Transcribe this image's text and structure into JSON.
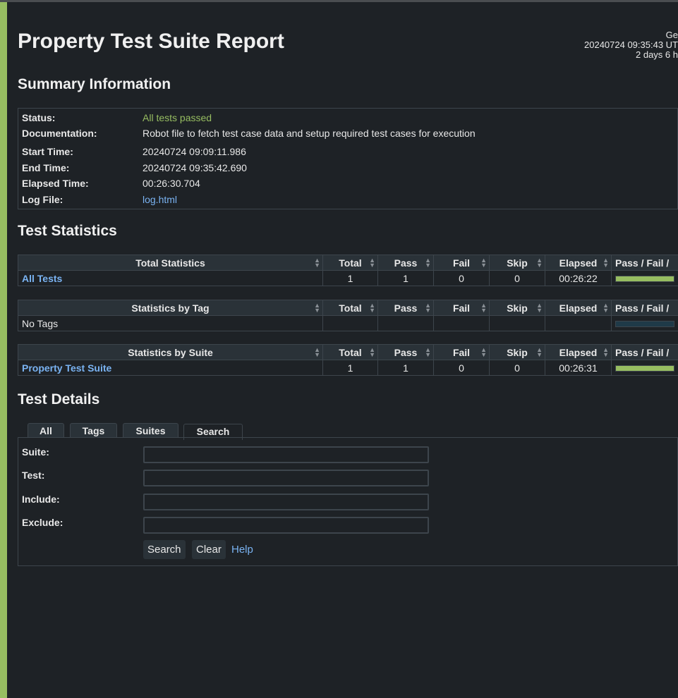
{
  "title": "Property Test Suite Report",
  "generated": {
    "line1": "Ge",
    "line2": "20240724 09:35:43 UT",
    "line3": "2 days 6 h"
  },
  "summary": {
    "heading": "Summary Information",
    "rows": [
      {
        "label": "Status:",
        "value": "All tests passed"
      },
      {
        "label": "Documentation:",
        "value": "Robot file to fetch test case data and setup required test cases for execution"
      },
      {
        "label": "Start Time:",
        "value": "20240724 09:09:11.986"
      },
      {
        "label": "End Time:",
        "value": "20240724 09:35:42.690"
      },
      {
        "label": "Elapsed Time:",
        "value": "00:26:30.704"
      },
      {
        "label": "Log File:",
        "value": "log.html"
      }
    ]
  },
  "statistics": {
    "heading": "Test Statistics",
    "columns": [
      "Total",
      "Pass",
      "Fail",
      "Skip",
      "Elapsed",
      "Pass / Fail /"
    ],
    "tables": [
      {
        "title": "Total Statistics",
        "row": {
          "name": "All Tests",
          "link": true,
          "total": "1",
          "pass": "1",
          "fail": "0",
          "skip": "0",
          "elapsed": "00:26:22",
          "pass_fraction": 1
        }
      },
      {
        "title": "Statistics by Tag",
        "row": {
          "name": "No Tags",
          "link": false,
          "total": "",
          "pass": "",
          "fail": "",
          "skip": "",
          "elapsed": "",
          "pass_fraction": 0
        }
      },
      {
        "title": "Statistics by Suite",
        "row": {
          "name": "Property Test Suite",
          "link": true,
          "total": "1",
          "pass": "1",
          "fail": "0",
          "skip": "0",
          "elapsed": "00:26:31",
          "pass_fraction": 1
        }
      }
    ]
  },
  "details": {
    "heading": "Test Details",
    "tabs": [
      "All",
      "Tags",
      "Suites",
      "Search"
    ],
    "active_tab": "Search",
    "fields": [
      {
        "label": "Suite:",
        "value": ""
      },
      {
        "label": "Test:",
        "value": ""
      },
      {
        "label": "Include:",
        "value": ""
      },
      {
        "label": "Exclude:",
        "value": ""
      }
    ],
    "search_label": "Search",
    "clear_label": "Clear",
    "help_label": "Help"
  },
  "colors": {
    "pass": "#97bd61",
    "link": "#7ab3f2",
    "background": "#1e2226"
  }
}
